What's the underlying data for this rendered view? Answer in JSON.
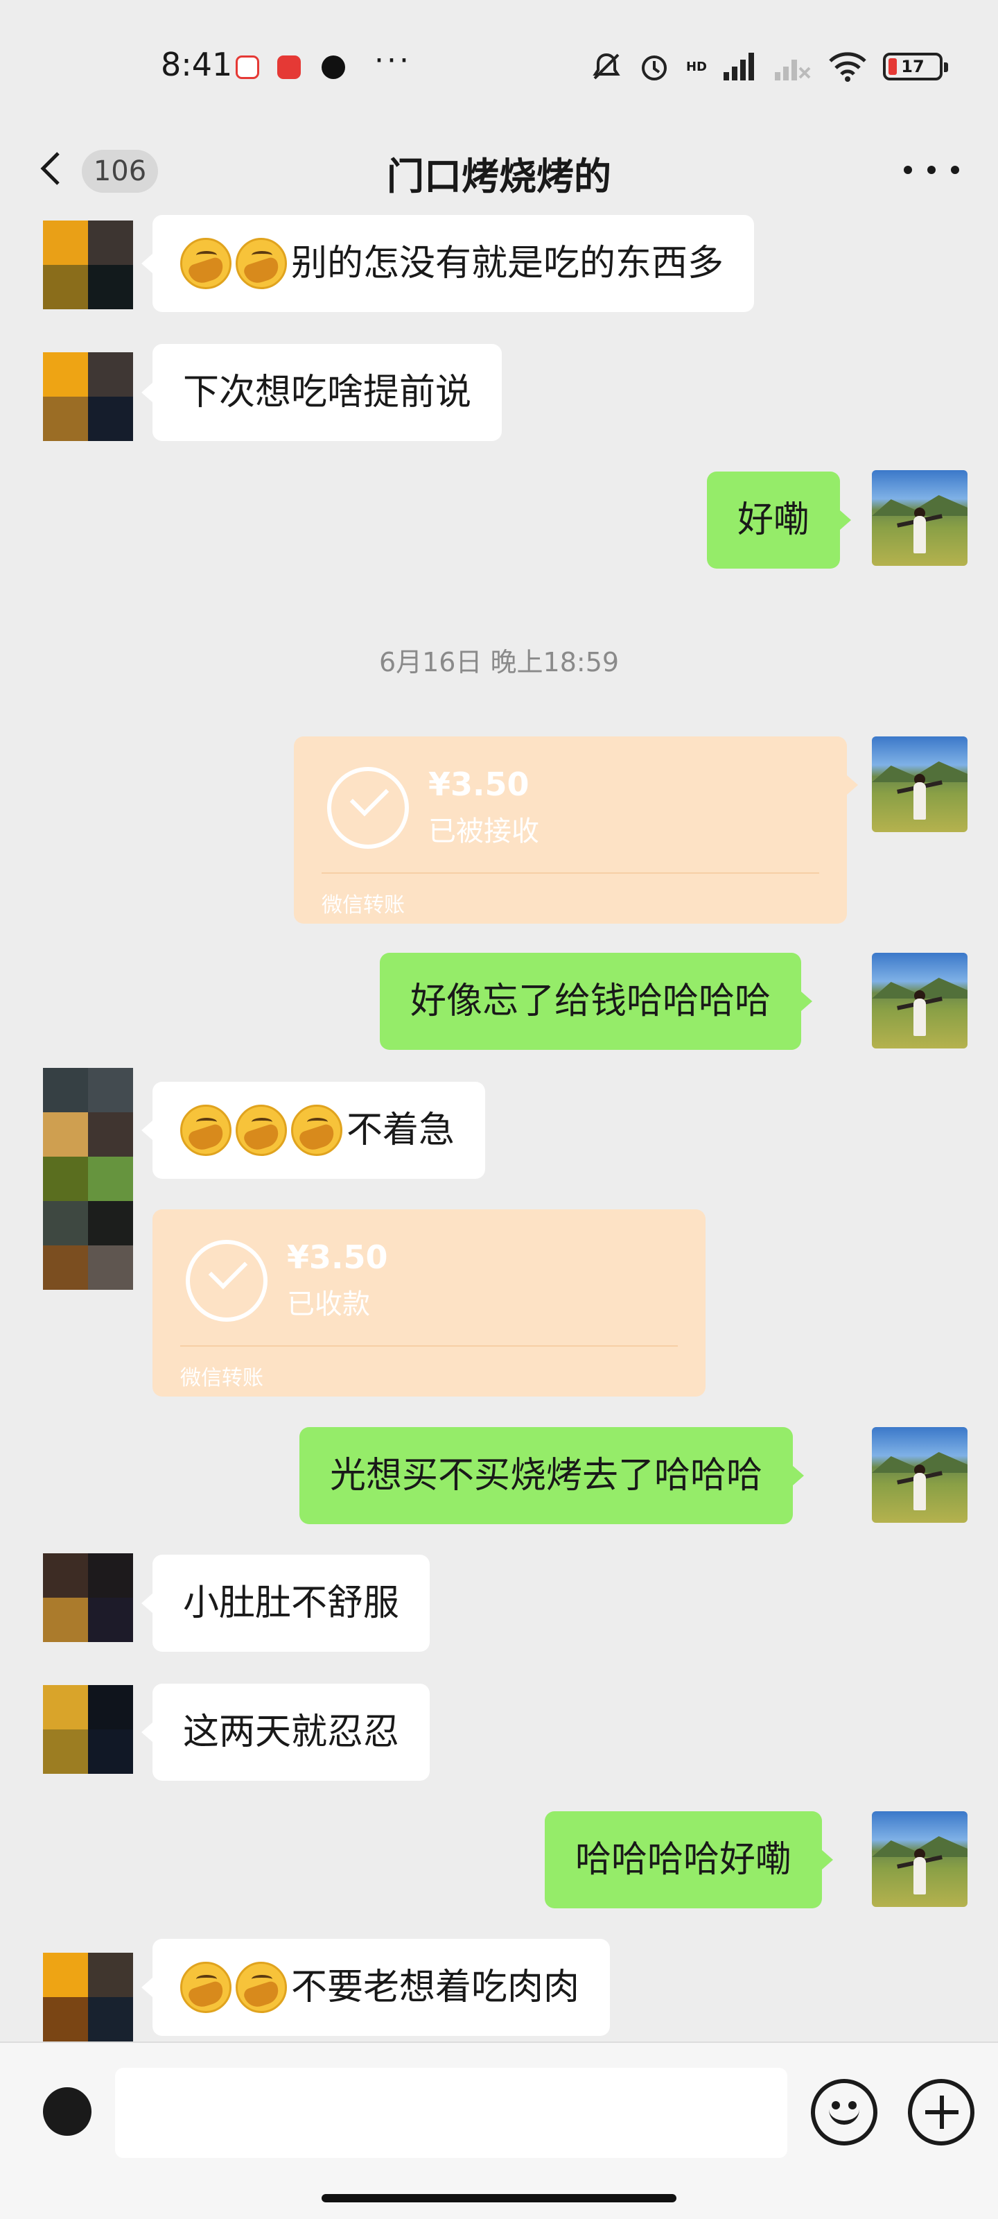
{
  "status_bar": {
    "time": "8:41",
    "dots": "···",
    "battery": "17",
    "network_label": "HD"
  },
  "header": {
    "unread_count": "106",
    "title": "门口烤烧烤的"
  },
  "messages": [
    {
      "side": "in",
      "emoji_count": 2,
      "text": "别的怎没有就是吃的东西多"
    },
    {
      "side": "in",
      "emoji_count": 0,
      "text": "下次想吃啥提前说"
    },
    {
      "side": "out",
      "emoji_count": 0,
      "text": "好嘞"
    },
    {
      "side": "out",
      "emoji_count": 0,
      "text": "好像忘了给钱哈哈哈哈"
    },
    {
      "side": "in",
      "emoji_count": 3,
      "text": "不着急"
    },
    {
      "side": "out",
      "emoji_count": 0,
      "text": "光想买不买烧烤去了哈哈哈"
    },
    {
      "side": "in",
      "emoji_count": 0,
      "text": "小肚肚不舒服"
    },
    {
      "side": "in",
      "emoji_count": 0,
      "text": "这两天就忍忍"
    },
    {
      "side": "out",
      "emoji_count": 0,
      "text": "哈哈哈哈好嘞"
    },
    {
      "side": "in",
      "emoji_count": 2,
      "text": "不要老想着吃肉肉"
    }
  ],
  "timestamp": "6月16日 晚上18:59",
  "transfers": [
    {
      "side": "out",
      "amount": "¥3.50",
      "status": "已被接收",
      "label": "微信转账"
    },
    {
      "side": "in",
      "amount": "¥3.50",
      "status": "已收款",
      "label": "微信转账"
    }
  ],
  "colors": {
    "background": "#ededed",
    "outgoing_bubble": "#95ec69",
    "incoming_bubble": "#ffffff",
    "transfer_card": "#fde2c5"
  },
  "input": {
    "placeholder": ""
  }
}
